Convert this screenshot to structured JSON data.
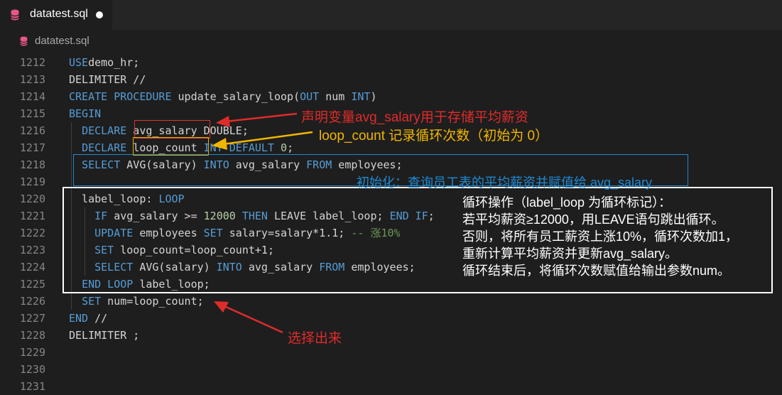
{
  "tab": {
    "title": "datatest.sql",
    "icon": "database-icon",
    "dirty": true
  },
  "breadcrumb": {
    "title": "datatest.sql",
    "icon": "database-icon"
  },
  "line_numbers": [
    "1212",
    "1213",
    "1214",
    "1215",
    "1216",
    "1217",
    "1218",
    "1219",
    "1220",
    "1221",
    "1222",
    "1223",
    "1224",
    "1225",
    "1226",
    "1227",
    "1228",
    "1229",
    "1230",
    "1231"
  ],
  "code_lines": [
    [
      [
        "kw",
        "USE"
      ],
      [
        "",
        "demo_hr;"
      ]
    ],
    [
      [
        "",
        "DELIMITER //"
      ]
    ],
    [
      [
        "kw",
        "CREATE PROCEDURE"
      ],
      [
        "",
        " update_salary_loop("
      ],
      [
        "kw",
        "OUT"
      ],
      [
        "",
        " num "
      ],
      [
        "kw",
        "INT"
      ],
      [
        "",
        ")"
      ]
    ],
    [
      [
        "kw",
        "BEGIN"
      ]
    ],
    [
      [
        "",
        "  "
      ],
      [
        "kw",
        "DECLARE"
      ],
      [
        "",
        " avg_salary DOUBLE;"
      ]
    ],
    [
      [
        "",
        "  "
      ],
      [
        "kw",
        "DECLARE"
      ],
      [
        "",
        " loop_count "
      ],
      [
        "kw",
        "INT DEFAULT"
      ],
      [
        "",
        " "
      ],
      [
        "num",
        "0"
      ],
      [
        "",
        ";"
      ]
    ],
    [
      [
        "",
        "  "
      ],
      [
        "kw",
        "SELECT"
      ],
      [
        "",
        " AVG(salary) "
      ],
      [
        "kw",
        "INTO"
      ],
      [
        "",
        " avg_salary "
      ],
      [
        "kw",
        "FROM"
      ],
      [
        "",
        " employees;"
      ]
    ],
    [],
    [
      [
        "",
        "  label_loop: "
      ],
      [
        "kw",
        "LOOP"
      ]
    ],
    [
      [
        "",
        "    "
      ],
      [
        "kw",
        "IF"
      ],
      [
        "",
        " avg_salary >= "
      ],
      [
        "num",
        "12000"
      ],
      [
        "",
        " "
      ],
      [
        "kw",
        "THEN"
      ],
      [
        "",
        " LEAVE label_loop; "
      ],
      [
        "kw",
        "END IF"
      ],
      [
        "",
        ";"
      ]
    ],
    [
      [
        "",
        "    "
      ],
      [
        "kw",
        "UPDATE"
      ],
      [
        "",
        " employees "
      ],
      [
        "kw",
        "SET"
      ],
      [
        "",
        " salary=salary*1.1; "
      ],
      [
        "cm",
        "-- 涨10%"
      ]
    ],
    [
      [
        "",
        "    "
      ],
      [
        "kw",
        "SET"
      ],
      [
        "",
        " loop_count=loop_count+1;"
      ]
    ],
    [
      [
        "",
        "    "
      ],
      [
        "kw",
        "SELECT"
      ],
      [
        "",
        " AVG(salary) "
      ],
      [
        "kw",
        "INTO"
      ],
      [
        "",
        " avg_salary "
      ],
      [
        "kw",
        "FROM"
      ],
      [
        "",
        " employees;"
      ]
    ],
    [
      [
        "",
        "  "
      ],
      [
        "kw",
        "END LOOP"
      ],
      [
        "",
        " label_loop;"
      ]
    ],
    [
      [
        "",
        "  "
      ],
      [
        "kw",
        "SET"
      ],
      [
        "",
        " num=loop_count;"
      ]
    ],
    [
      [
        "kw",
        "END"
      ],
      [
        "",
        " //"
      ]
    ],
    [
      [
        "",
        "DELIMITER ;"
      ]
    ],
    [],
    [],
    []
  ],
  "annotations": {
    "declare_avg": "声明变量avg_salary用于存储平均薪资",
    "declare_loop": "loop_count 记录循环次数（初始为 0）",
    "init_select": "初始化：查询员工表的平均薪资并赋值给 avg_salary",
    "loop_box": [
      "循环操作（label_loop 为循环标记）：",
      "若平均薪资≥12000，用LEAVE语句跳出循环。",
      "否则，将所有员工薪资上涨10%，循环次数加1，",
      "重新计算平均薪资并更新avg_salary。",
      "循环结束后，将循环次数赋值给输出参数num。"
    ],
    "select_out": "选择出来"
  },
  "colors": {
    "red": "#e02b2b",
    "orange": "#f2b600",
    "blue": "#1f8ad2",
    "white": "#ffffff"
  }
}
